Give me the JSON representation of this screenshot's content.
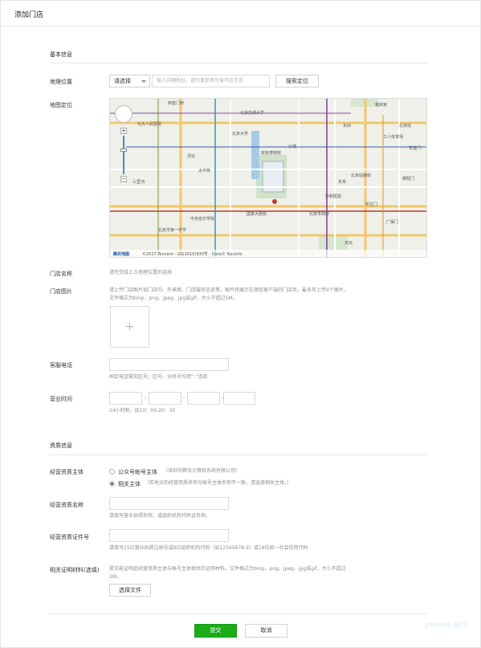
{
  "page": {
    "title": "添加门店"
  },
  "basic": {
    "section_title": "基本信息",
    "location_label": "地理位置",
    "select_value": "请选择",
    "address_placeholder": "输入详细地址，请勿重复填写省市区信息",
    "search_button": "搜索定位",
    "map_label": "地图定位",
    "map": {
      "places": [
        "西直门桥",
        "雍和宫",
        "北京交通大学",
        "北大人民医院",
        "北京站",
        "沙滩",
        "故宫博物院",
        "月坛",
        "太平桥",
        "三里河",
        "北京大学",
        "中央音乐学院",
        "国家大剧院",
        "北京市政府",
        "协和医院",
        "北京站西街",
        "工人体育场",
        "东四",
        "东单",
        "广渠门",
        "崇文门",
        "天坛",
        "北京市第一中学",
        "东直门",
        "朝阳门"
      ],
      "footer_logo": "腾讯地图",
      "copyright": "©2017 Tencent - GS(2016)930号 - Data© NavInfo"
    },
    "store_name_label": "门店名称",
    "store_name_hint": "请先完成上方地理位置的选择",
    "store_images_label": "门店图片",
    "store_images_hint": "请上传门店图片如门店内、外景图、门店服务信息等，图片将展示在微信客户端的门店页。最多可上传9个图片，文件格式为bmp、png、jpeg、jpg或gif，大小不超过5M。",
    "upload_plus": "+",
    "phone_label": "客服电话",
    "phone_hint": "固定电话需加区号；区号、分机号均用“-”连接",
    "hours_label": "营业时间",
    "hours_colon": ":",
    "hours_dash": "-",
    "hours_hint": "24小时制，如10：00-20：30"
  },
  "qualification": {
    "section_title": "资质信息",
    "subject_label": "经营资质主体",
    "option1_label": "公众号帐号主体",
    "option1_note": "（深圳市腾讯计算机系统有限公司）",
    "option2_label": "相关主体",
    "option2_note": "（若地点的经营资质名称与帐号主体名称不一致，请选择相关主体。）",
    "name_label": "经营资质名称",
    "name_hint": "请填写营业执照名称，或组织机构代码证名称。",
    "cert_label": "经营资质证件号",
    "cert_hint": "请填写15位营业执照注册号或9位组织机构代码（如12345678-9）或18位统一社会信用代码",
    "proof_label": "相关证明材料(选填)",
    "proof_hint": "提交能证明此经营资质主体与帐号主体相关的证明材料。文件格式为bmp、png、jpeg、jpg或gif，大小不超过2M。",
    "choose_file_button": "选择文件"
  },
  "footer": {
    "submit": "提交",
    "cancel": "取消",
    "watermark": "pHome.NET"
  }
}
